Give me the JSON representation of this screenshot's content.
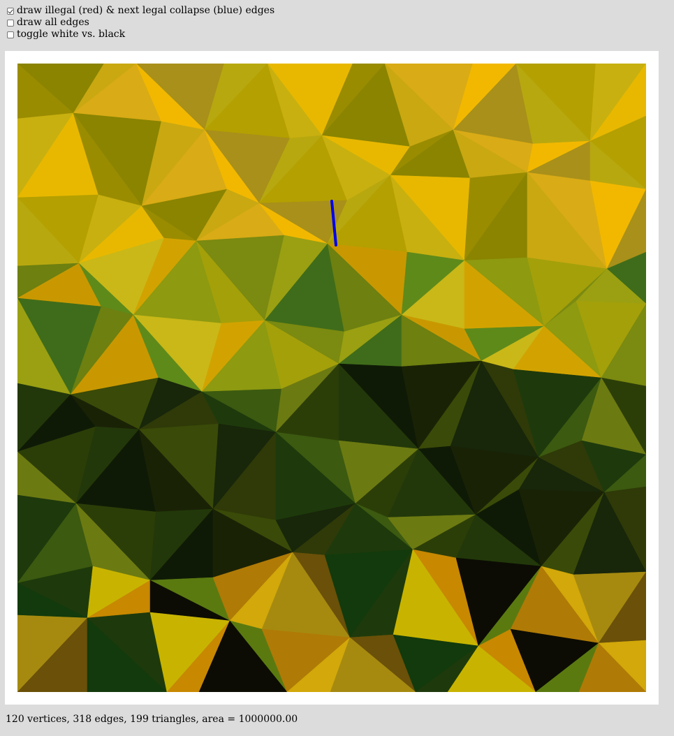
{
  "controls": {
    "illegal_edges": {
      "label": "draw illegal (red) & next legal collapse (blue) edges",
      "checked": true
    },
    "all_edges": {
      "label": "draw all edges",
      "checked": false
    },
    "toggle_color": {
      "label": "toggle white vs. black",
      "checked": false
    }
  },
  "status": {
    "text": "120 vertices, 318 edges, 199 triangles, area = 1000000.00"
  },
  "mesh": {
    "edge_color_collapse": "#0000ee"
  }
}
